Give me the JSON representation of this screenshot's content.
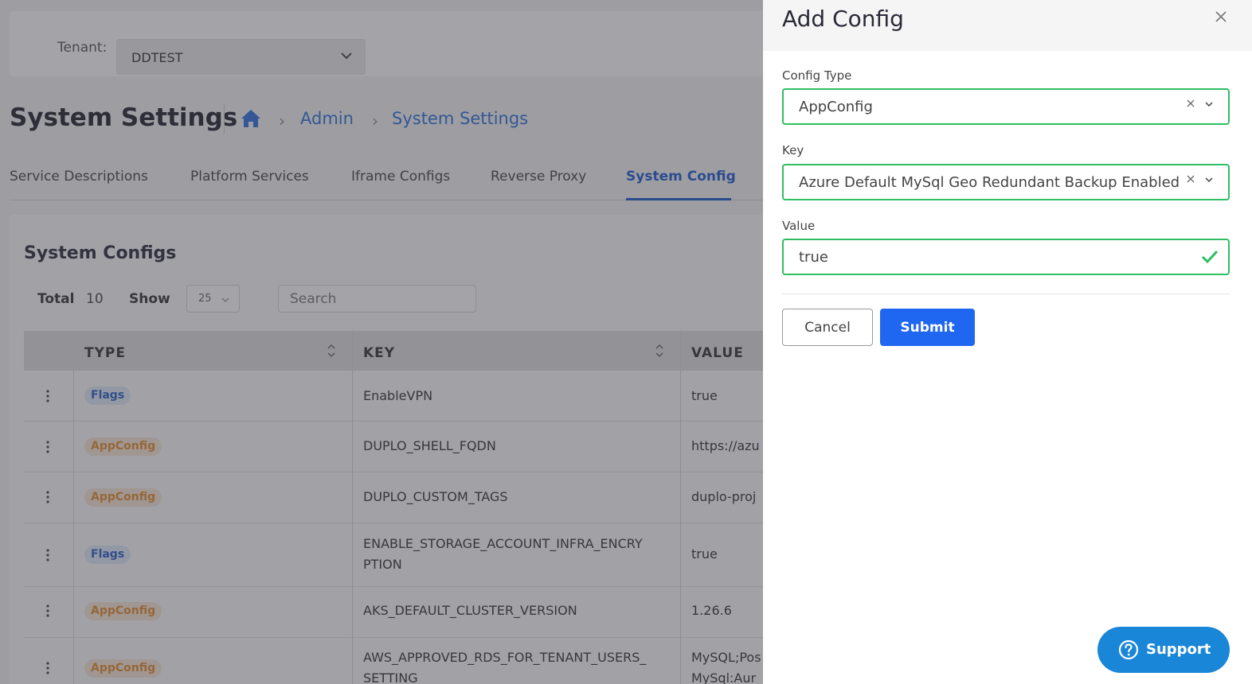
{
  "tenant": {
    "label": "Tenant:",
    "value": "DDTEST"
  },
  "page": {
    "title": "System Settings"
  },
  "breadcrumb": {
    "home_icon": "home-icon",
    "items": [
      "Admin",
      "System Settings"
    ]
  },
  "tabs": [
    {
      "label": "Service Descriptions",
      "active": false
    },
    {
      "label": "Platform Services",
      "active": false
    },
    {
      "label": "Iframe Configs",
      "active": false
    },
    {
      "label": "Reverse Proxy",
      "active": false
    },
    {
      "label": "System Config",
      "active": true
    }
  ],
  "configs": {
    "title": "System Configs",
    "total_label": "Total",
    "total": "10",
    "show_label": "Show",
    "show_value": "25",
    "search_placeholder": "Search",
    "columns": [
      "TYPE",
      "KEY",
      "VALUE"
    ],
    "rows": [
      {
        "type": "Flags",
        "key": "EnableVPN",
        "value": "true"
      },
      {
        "type": "AppConfig",
        "key": "DUPLO_SHELL_FQDN",
        "value": "https://azu"
      },
      {
        "type": "AppConfig",
        "key": "DUPLO_CUSTOM_TAGS",
        "value": "duplo-proj"
      },
      {
        "type": "Flags",
        "key": "ENABLE_STORAGE_ACCOUNT_INFRA_ENCRY",
        "key2": "PTION",
        "value": "true"
      },
      {
        "type": "AppConfig",
        "key": "AKS_DEFAULT_CLUSTER_VERSION",
        "value": "1.26.6"
      },
      {
        "type": "AppConfig",
        "key": "AWS_APPROVED_RDS_FOR_TENANT_USERS_",
        "key2": "SETTING",
        "value": "MySQL;Pos",
        "value2": "MySql:Aur"
      }
    ]
  },
  "drawer": {
    "title": "Add Config",
    "config_type_label": "Config Type",
    "config_type_value": "AppConfig",
    "key_label": "Key",
    "key_value": "Azure Default MySql Geo Redundant Backup Enabled",
    "value_label": "Value",
    "value_value": "true",
    "cancel_label": "Cancel",
    "submit_label": "Submit"
  },
  "support": {
    "label": "Support"
  },
  "colors": {
    "accent": "#1f66f0",
    "valid": "#2fbe63",
    "support": "#1a86d8",
    "link": "#2d6fd6"
  }
}
